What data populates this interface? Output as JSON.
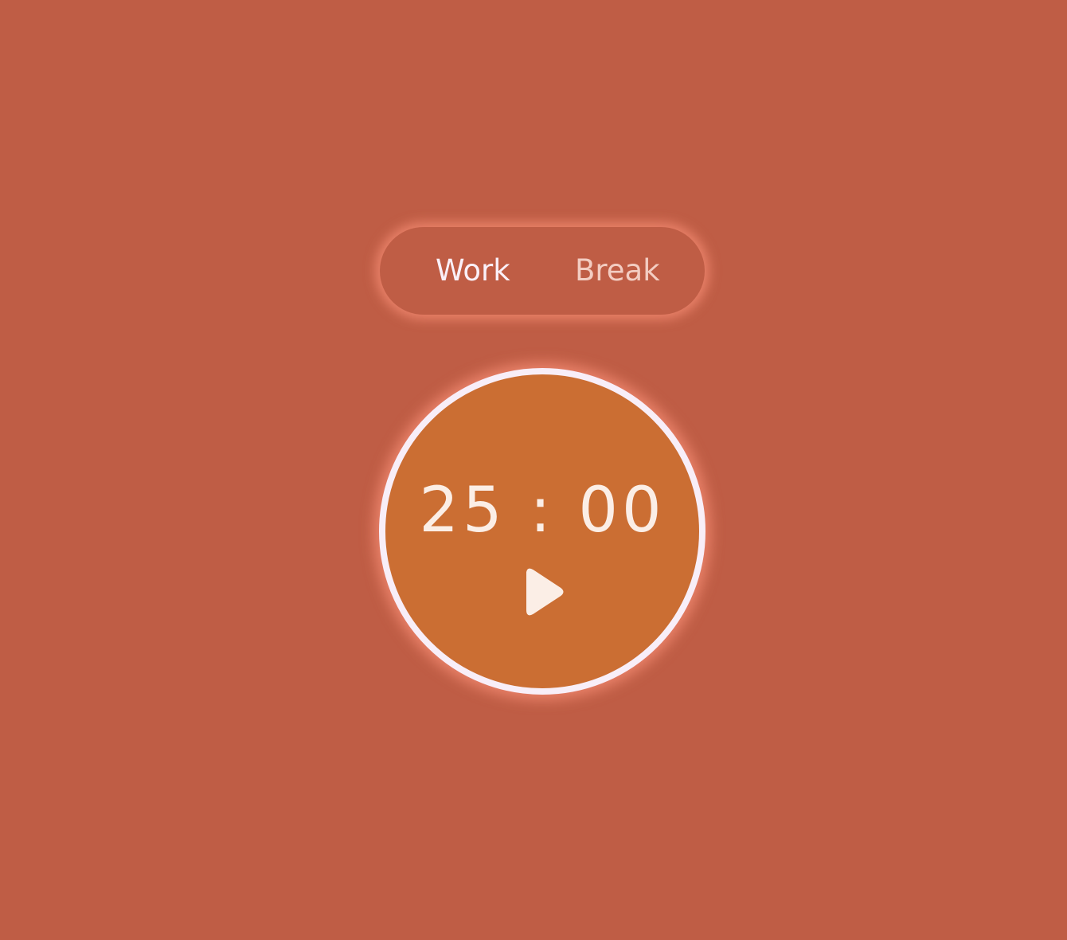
{
  "modes": {
    "work_label": "Work",
    "break_label": "Break",
    "active": "Work"
  },
  "timer": {
    "time_text": "25 : 00",
    "action_icon": "play-icon"
  },
  "colors": {
    "background": "#bf5d45",
    "dial_fill": "#cb6e33",
    "dial_ring": "#f8eef8",
    "glow": "#f0876e",
    "text_light": "#fbeee6"
  }
}
